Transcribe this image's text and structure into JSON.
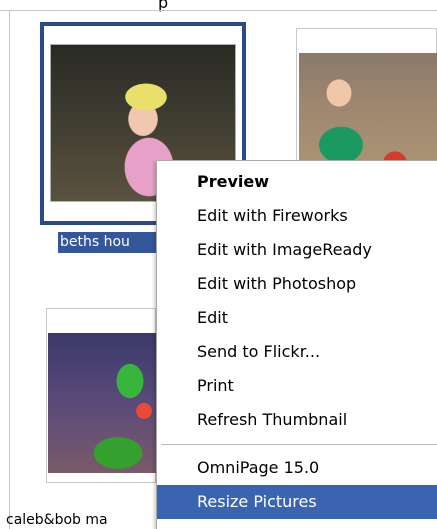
{
  "top_fragment": "p",
  "thumbnails": [
    {
      "icon": "photo-girl-yellow-hat",
      "label": "beths hou",
      "selected": true
    },
    {
      "icon": "photo-toddler-toys",
      "label": "",
      "selected": false
    },
    {
      "icon": "photo-toy-train",
      "label": "caleb&bob ma",
      "selected": false
    }
  ],
  "context_menu": {
    "items": [
      {
        "label": "Preview",
        "default": true
      },
      {
        "label": "Edit with Fireworks"
      },
      {
        "label": "Edit with ImageReady"
      },
      {
        "label": "Edit with Photoshop"
      },
      {
        "label": "Edit"
      },
      {
        "label": "Send to Flickr..."
      },
      {
        "label": "Print"
      },
      {
        "label": "Refresh Thumbnail"
      },
      {
        "label": "OmniPage 15.0"
      },
      {
        "label": "Resize Pictures",
        "highlighted": true
      }
    ]
  },
  "colors": {
    "selection": "#34579b",
    "menu_highlight": "#3b64b0",
    "thumbnail_selected_border": "#2b4a87"
  }
}
